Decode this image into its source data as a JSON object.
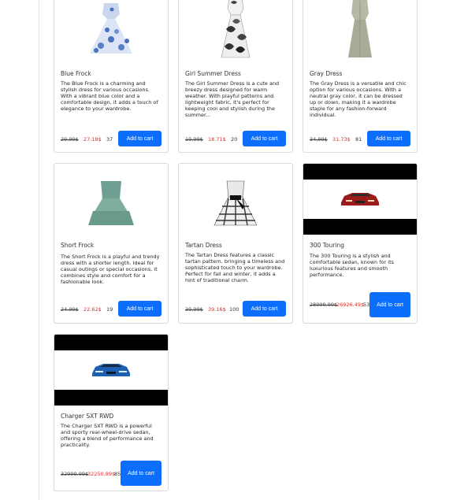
{
  "products": [
    {
      "title": "Blue Frock",
      "description": "The Blue Frock is a charming and stylish dress for various occasions. With a vibrant blue color and a comfortable design, it adds a touch of elegance to your wardrobe.",
      "old_price": "29.99$",
      "new_price": "27.18$",
      "stock": "37",
      "button": "Add to cart",
      "image_icon": "blue-polka-dot-dress-icon"
    },
    {
      "title": "Girl Summer Dress",
      "description": "The Girl Summer Dress is a cute and breezy dress designed for warm weather. With playful patterns and lightweight fabric, it's perfect for keeping cool and stylish during the summer...",
      "old_price": "19.99$",
      "new_price": "18.71$",
      "stock": "20",
      "button": "Add to cart",
      "image_icon": "leaf-print-dress-icon"
    },
    {
      "title": "Gray Dress",
      "description": "The Gray Dress is a versatile and chic option for various occasions. With a neutral gray color, it can be dressed up or down, making it a wardrobe staple for any fashion-forward individual.",
      "old_price": "34.99$",
      "new_price": "31.73$",
      "stock": "81",
      "button": "Add to cart",
      "image_icon": "gray-dress-icon"
    },
    {
      "title": "Short Frock",
      "description": "The Short Frock is a playful and trendy dress with a shorter length. Ideal for casual outings or special occasions, it combines style and comfort for a fashionable look.",
      "old_price": "24.99$",
      "new_price": "22.62$",
      "stock": "19",
      "button": "Add to cart",
      "image_icon": "green-ruffle-dress-icon"
    },
    {
      "title": "Tartan Dress",
      "description": "The Tartan Dress features a classic tartan pattern, bringing a timeless and sophisticated touch to your wardrobe. Perfect for fall and winter, it adds a hint of traditional charm.",
      "old_price": "39.99$",
      "new_price": "39.16$",
      "stock": "100",
      "button": "Add to cart",
      "image_icon": "tartan-dress-icon"
    },
    {
      "title": "300 Touring",
      "description": "The 300 Touring is a stylish and comfortable sedan, known for its luxurious features and smooth performance.",
      "old_price": "28999.99$",
      "new_price": "26926.49$",
      "stock": "53",
      "button": "Add to cart",
      "image_icon": "red-sedan-icon"
    },
    {
      "title": "Charger SXT RWD",
      "description": "The Charger SXT RWD is a powerful and sporty rear-wheel-drive sedan, offering a blend of performance and practicality.",
      "old_price": "32999.99$",
      "new_price": "32250.89$",
      "stock": "85",
      "button": "Add to cart",
      "image_icon": "blue-sedan-icon"
    }
  ]
}
